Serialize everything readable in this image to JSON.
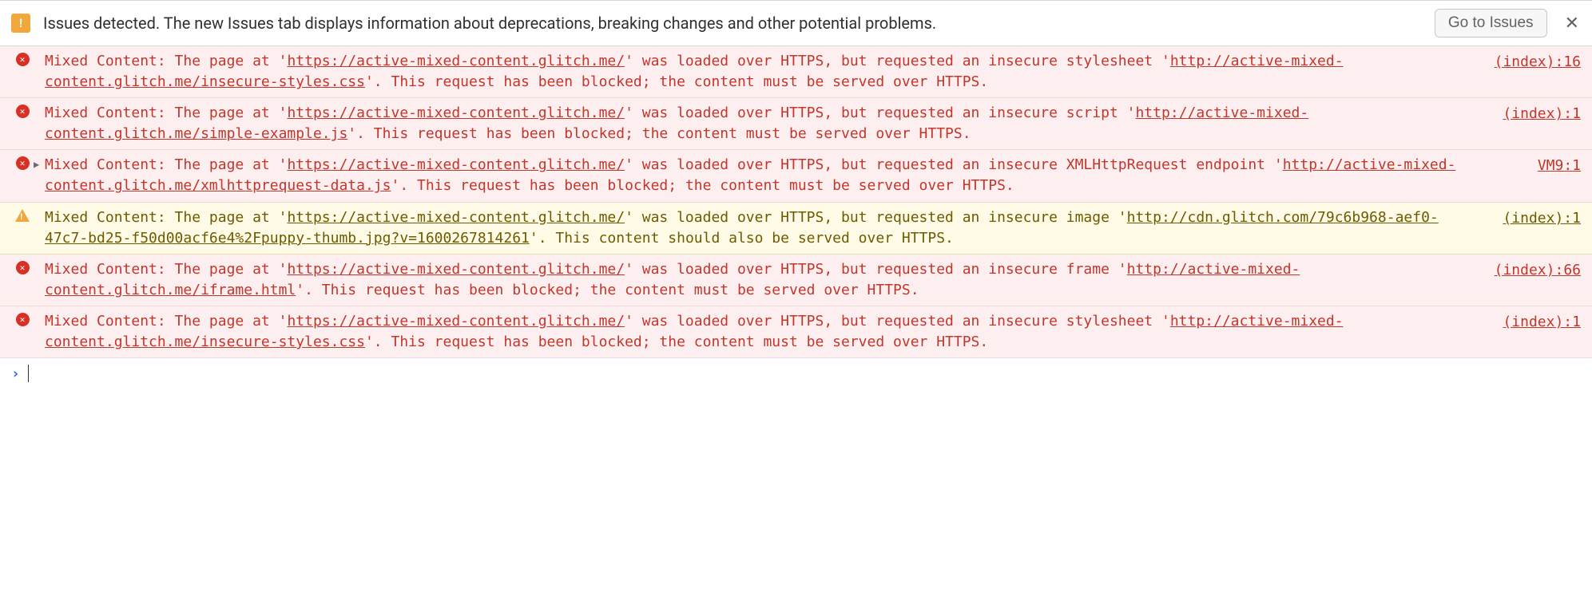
{
  "issuesBar": {
    "badgeGlyph": "!",
    "message": "Issues detected. The new Issues tab displays information about deprecations, breaking changes and other potential problems.",
    "buttonLabel": "Go to Issues",
    "closeGlyph": "✕"
  },
  "entries": [
    {
      "level": "error",
      "expandable": false,
      "source": "(index):16",
      "pre": "Mixed Content: The page at '",
      "page_url": "https://active-mixed-content.glitch.me/",
      "mid": "' was loaded over HTTPS, but requested an insecure stylesheet '",
      "res_url": "http://active-mixed-content.glitch.me/insecure-styles.css",
      "post": "'. This request has been blocked; the content must be served over HTTPS."
    },
    {
      "level": "error",
      "expandable": false,
      "source": "(index):1",
      "pre": "Mixed Content: The page at '",
      "page_url": "https://active-mixed-content.glitch.me/",
      "mid": "' was loaded over HTTPS, but requested an insecure script '",
      "res_url": "http://active-mixed-content.glitch.me/simple-example.js",
      "post": "'. This request has been blocked; the content must be served over HTTPS."
    },
    {
      "level": "error",
      "expandable": true,
      "source": "VM9:1",
      "pre": "Mixed Content: The page at '",
      "page_url": "https://active-mixed-content.glitch.me/",
      "mid": "' was loaded over HTTPS, but requested an insecure XMLHttpRequest endpoint '",
      "res_url": "http://active-mixed-content.glitch.me/xmlhttprequest-data.js",
      "post": "'. This request has been blocked; the content must be served over HTTPS."
    },
    {
      "level": "warn",
      "expandable": false,
      "source": "(index):1",
      "pre": "Mixed Content: The page at '",
      "page_url": "https://active-mixed-content.glitch.me/",
      "mid": "' was loaded over HTTPS, but requested an insecure image '",
      "res_url": "http://cdn.glitch.com/79c6b968-aef0-47c7-bd25-f50d00acf6e4%2Fpuppy-thumb.jpg?v=1600267814261",
      "post": "'. This content should also be served over HTTPS."
    },
    {
      "level": "error",
      "expandable": false,
      "source": "(index):66",
      "pre": "Mixed Content: The page at '",
      "page_url": "https://active-mixed-content.glitch.me/",
      "mid": "' was loaded over HTTPS, but requested an insecure frame '",
      "res_url": "http://active-mixed-content.glitch.me/iframe.html",
      "post": "'. This request has been blocked; the content must be served over HTTPS."
    },
    {
      "level": "error",
      "expandable": false,
      "source": "(index):1",
      "pre": "Mixed Content: The page at '",
      "page_url": "https://active-mixed-content.glitch.me/",
      "mid": "' was loaded over HTTPS, but requested an insecure stylesheet '",
      "res_url": "http://active-mixed-content.glitch.me/insecure-styles.css",
      "post": "'. This request has been blocked; the content must be served over HTTPS."
    }
  ],
  "prompt": {
    "chevron": "›"
  }
}
